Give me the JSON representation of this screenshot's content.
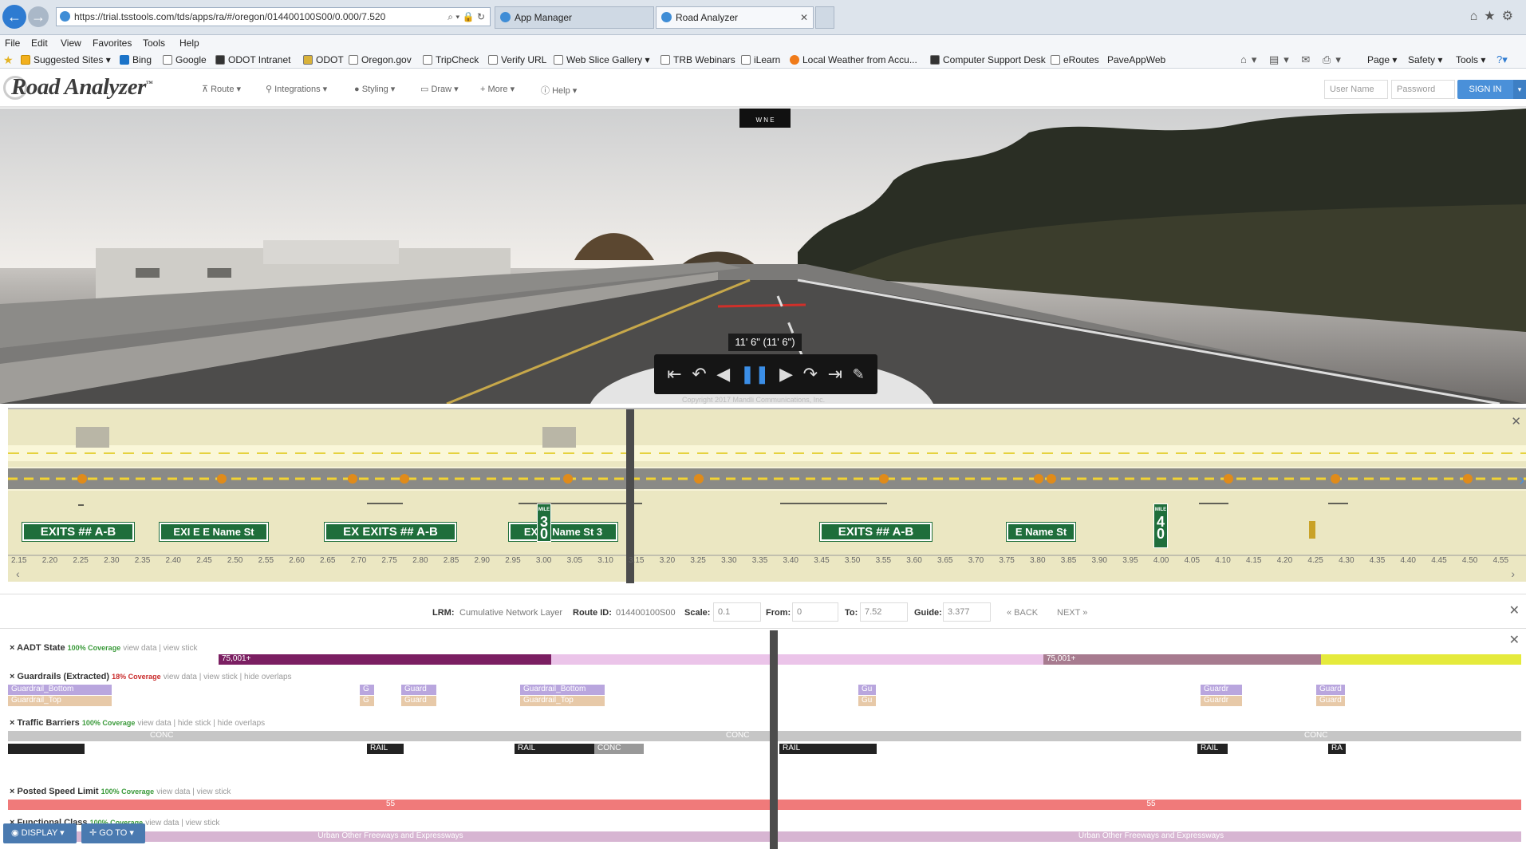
{
  "browser": {
    "url": "https://trial.tsstools.com/tds/apps/ra/#/oregon/014400100S00/0.000/7.520",
    "tabs": [
      {
        "label": "App Manager"
      },
      {
        "label": "Road Analyzer"
      }
    ],
    "menu": [
      "File",
      "Edit",
      "View",
      "Favorites",
      "Tools",
      "Help"
    ],
    "favorites": [
      "Suggested Sites ▾",
      "Bing",
      "Google",
      "ODOT Intranet",
      "ODOT",
      "Oregon.gov",
      "TripCheck",
      "Verify URL",
      "Web Slice Gallery ▾",
      "TRB Webinars",
      "iLearn",
      "Local Weather from Accu...",
      "Computer Support Desk",
      "eRoutes",
      "PaveAppWeb"
    ],
    "commands": [
      "Page ▾",
      "Safety ▾",
      "Tools ▾"
    ]
  },
  "app": {
    "logo": "Road Analyzer",
    "trademark": "™",
    "menu": [
      "Route ▾",
      "Integrations ▾",
      "Styling ▾",
      "Draw ▾",
      "More ▾",
      "Help ▾"
    ],
    "username_placeholder": "User Name",
    "password_placeholder": "Password",
    "signin": "SIGN IN"
  },
  "viewer": {
    "compass": "W N E",
    "measurement": "11' 6\" (11' 6\")",
    "copyright": "Copyright 2017 Mandli Communications, Inc."
  },
  "sld": {
    "ticks": [
      "2.15",
      "2.20",
      "2.25",
      "2.30",
      "2.35",
      "2.40",
      "2.45",
      "2.50",
      "2.55",
      "2.60",
      "2.65",
      "2.70",
      "2.75",
      "2.80",
      "2.85",
      "2.90",
      "2.95",
      "3.00",
      "3.05",
      "3.10",
      "3.15",
      "3.20",
      "3.25",
      "3.30",
      "3.35",
      "3.40",
      "3.45",
      "3.50",
      "3.55",
      "3.60",
      "3.65",
      "3.70",
      "3.75",
      "3.80",
      "3.85",
      "3.90",
      "3.95",
      "4.00",
      "4.05",
      "4.10",
      "4.15",
      "4.20",
      "4.25",
      "4.30",
      "4.35",
      "4.40",
      "4.45",
      "4.50",
      "4.55"
    ],
    "signs": [
      {
        "text": "EXITS  ## A-B"
      },
      {
        "text": "EXI E  E Name St"
      },
      {
        "text": "EX EXITS  ## A-B"
      },
      {
        "text": "EXI 3  Name St 3"
      },
      {
        "text": "EXITS  ## A-B"
      },
      {
        "text": "E Name St"
      }
    ],
    "mile_signs": [
      {
        "label": "MILE",
        "num": "3\n0"
      },
      {
        "label": "MILE",
        "num": "4\n0"
      }
    ]
  },
  "lrm": {
    "lrm_label": "LRM:",
    "lrm_value": "Cumulative Network Layer",
    "route_label": "Route ID:",
    "route_value": "014400100S00",
    "scale_label": "Scale:",
    "scale_value": "0.1",
    "from_label": "From:",
    "from_value": "0",
    "to_label": "To:",
    "to_value": "7.52",
    "guide_label": "Guide:",
    "guide_value": "3.377",
    "back": "« BACK",
    "next": "NEXT »"
  },
  "layers": {
    "aadt": {
      "title": "AADT State",
      "coverage": "100% Coverage",
      "links": "view data  | view stick",
      "seg1": "75,001+",
      "seg2": "75,001+"
    },
    "guardrails": {
      "title": "Guardrails (Extracted)",
      "coverage": "18% Coverage",
      "links": "view data  | view stick  |  hide overlaps",
      "bottom": "Guardrail_Bottom",
      "top": "Guardrail_Top",
      "short": "Guardr",
      "g": "G",
      "g2": "Gu",
      "g3": "Guard"
    },
    "barriers": {
      "title": "Traffic Barriers",
      "coverage": "100% Coverage",
      "links": "view data  | hide stick  |  hide overlaps",
      "conc": "CONC",
      "rail": "RAIL",
      "ra": "RA"
    },
    "speed": {
      "title": "Posted Speed Limit",
      "coverage": "100% Coverage",
      "links": "view data  | view stick",
      "value": "55"
    },
    "func": {
      "title": "Functional Class",
      "coverage": "100% Coverage",
      "links": "view data  | view stick",
      "value": "Urban Other Freeways and Expressways"
    }
  },
  "bottom": {
    "display": "DISPLAY ▾",
    "goto": "GO TO ▾"
  },
  "colors": {
    "accent": "#4a90d9",
    "aadt_dark": "#7b1f62",
    "aadt_light": "#ebc4e9",
    "aadt_mid": "#a77b8f",
    "aadt_yellow": "#e5ea3c",
    "speed": "#f07a7a",
    "func": "#d7b5d2",
    "guard": "#b9a6de",
    "guard_top": "#e7c9a8"
  }
}
